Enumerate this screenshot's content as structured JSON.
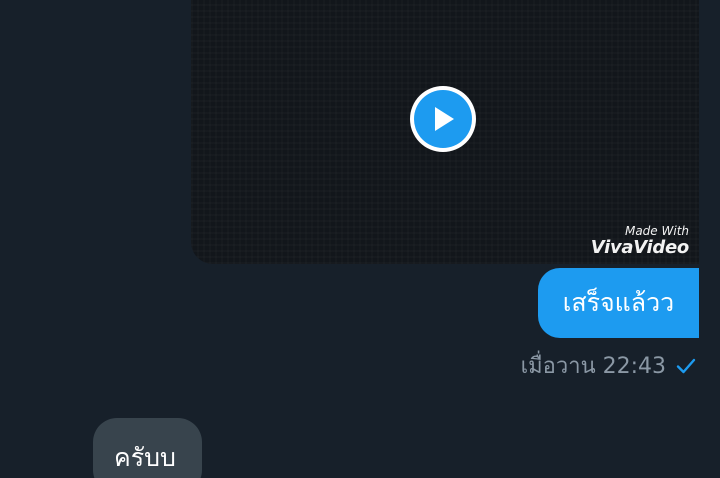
{
  "messages": {
    "video": {
      "watermark_line1": "Made With",
      "watermark_line2": "VivaVideo",
      "play_icon": "play-icon"
    },
    "outgoing_text": "เสร็จแล้วว",
    "outgoing_meta": {
      "time": "เมื่อวาน 22:43",
      "status_icon": "check-icon"
    },
    "incoming_text": "ครับบ"
  },
  "colors": {
    "background": "#17202a",
    "outgoing_bubble": "#1d9bf0",
    "incoming_bubble": "#38444d",
    "meta_text": "#8b98a5"
  }
}
